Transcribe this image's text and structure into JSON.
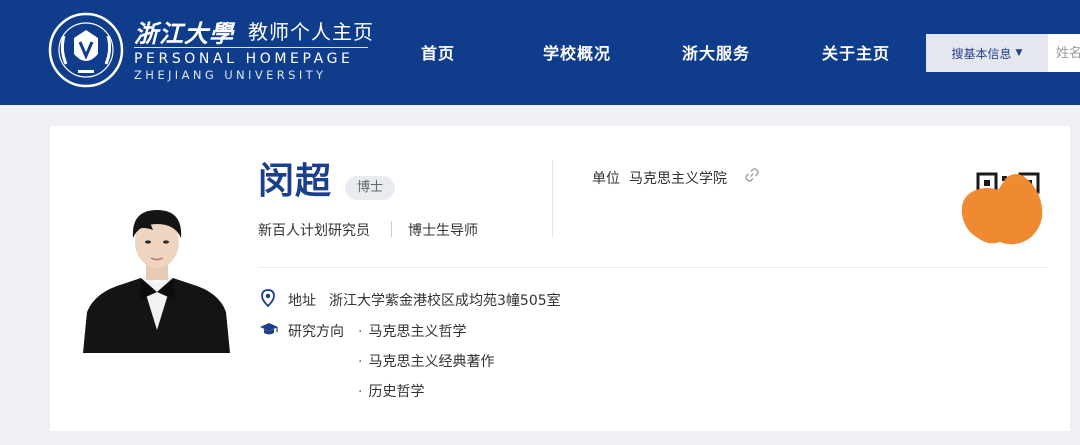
{
  "header": {
    "logo_cn": "浙江大學",
    "logo_cn_sub": "教师个人主页",
    "logo_en_line1": "PERSONAL HOMEPAGE",
    "logo_en_line2": "ZHEJIANG UNIVERSITY",
    "nav": [
      "首页",
      "学校概况",
      "浙大服务",
      "关于主页"
    ],
    "search": {
      "select_label": "搜基本信息",
      "placeholder": "姓名"
    },
    "colors": {
      "bar": "#0f3d8c",
      "text": "#ffffff"
    }
  },
  "profile": {
    "name": "闵超",
    "degree": "博士",
    "titles": [
      "新百人计划研究员",
      "博士生导师"
    ],
    "unit_label": "单位",
    "unit_value": "马克思主义学院",
    "address_label": "地址",
    "address_value": "浙江大学紫金港校区成均苑3幢505室",
    "research_label": "研究方向",
    "research_areas": [
      "马克思主义哲学",
      "马克思主义经典著作",
      "历史哲学"
    ],
    "colors": {
      "name": "#1a3f8f",
      "accent": "#1a3f8f",
      "obscured_mark": "#f08a32"
    }
  },
  "icons": {
    "logo": "university-seal-icon",
    "link": "link-icon",
    "location": "location-pin-icon",
    "research": "graduation-cap-icon",
    "qr": "qr-code-icon",
    "dropdown": "caret-down-icon"
  }
}
